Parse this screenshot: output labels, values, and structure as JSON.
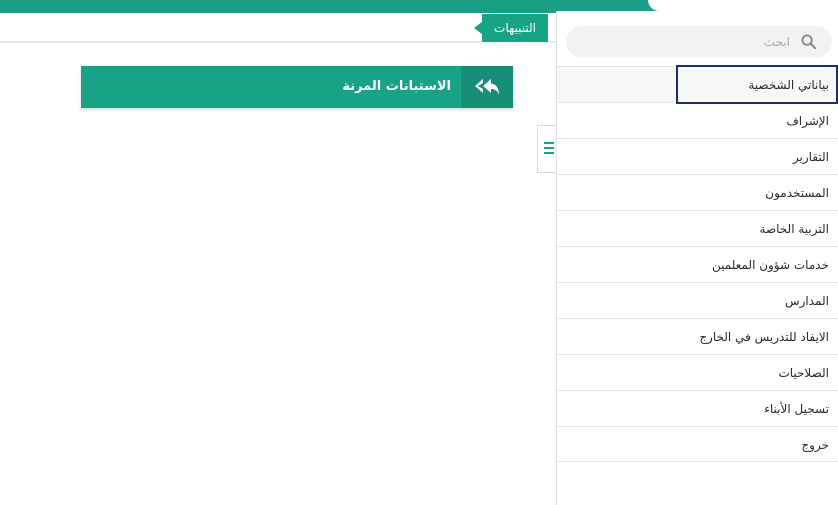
{
  "header": {
    "alerts_tab_label": "التنبيهات"
  },
  "search": {
    "placeholder": "ابحث"
  },
  "sidebar": {
    "items": [
      {
        "label": "بياناتي الشخصية"
      },
      {
        "label": "الإشراف"
      },
      {
        "label": "التقارير"
      },
      {
        "label": "المستخدمون"
      },
      {
        "label": "التربية الخاصة"
      },
      {
        "label": "خدمات شؤون المعلمين"
      },
      {
        "label": "المدارس"
      },
      {
        "label": "الايفاد للتدريس في الخارج"
      },
      {
        "label": "الصلاحيات"
      },
      {
        "label": "تسجيل الأبناء"
      },
      {
        "label": "خروج"
      }
    ]
  },
  "main": {
    "card_title": "الاستبانات المرنة",
    "card_icon": "reply-all-icon"
  },
  "colors": {
    "accent": "#18a386",
    "accent_dark": "#168f76",
    "focus_outline": "#1b2f6e"
  }
}
